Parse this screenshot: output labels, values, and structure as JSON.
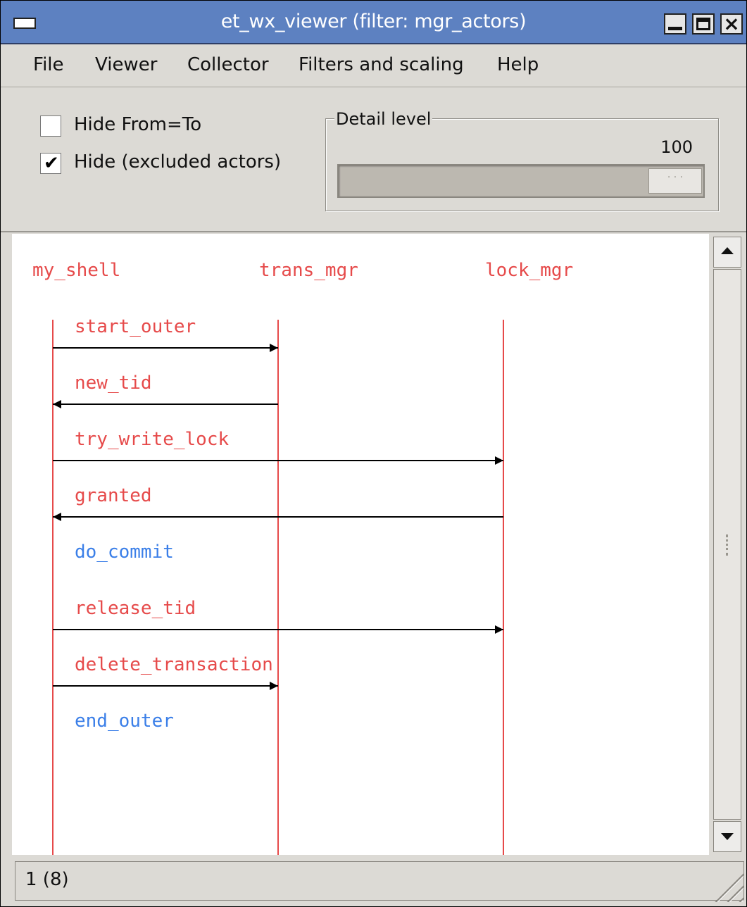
{
  "window": {
    "title": "et_wx_viewer (filter: mgr_actors)"
  },
  "menu": [
    "File",
    "Viewer",
    "Collector",
    "Filters and scaling",
    "Help"
  ],
  "controls": {
    "hide_from_to": {
      "label": "Hide From=To",
      "checked": false
    },
    "hide_excluded": {
      "label": "Hide (excluded actors)",
      "checked": true
    },
    "detail_level": {
      "legend": "Detail level",
      "value": "100"
    }
  },
  "diagram": {
    "actors": [
      "my_shell",
      "trans_mgr",
      "lock_mgr"
    ],
    "events": [
      {
        "label": "start_outer",
        "from": 0,
        "to": 1,
        "color": "#e64a4a"
      },
      {
        "label": "new_tid",
        "from": 1,
        "to": 0,
        "color": "#e64a4a"
      },
      {
        "label": "try_write_lock",
        "from": 0,
        "to": 2,
        "color": "#e64a4a"
      },
      {
        "label": "granted",
        "from": 2,
        "to": 0,
        "color": "#e64a4a"
      },
      {
        "label": "do_commit",
        "from": null,
        "to": null,
        "color": "#3b7fe8"
      },
      {
        "label": "release_tid",
        "from": 0,
        "to": 2,
        "color": "#e64a4a"
      },
      {
        "label": "delete_transaction",
        "from": 0,
        "to": 1,
        "color": "#e64a4a"
      },
      {
        "label": "end_outer",
        "from": null,
        "to": null,
        "color": "#3b7fe8"
      }
    ],
    "actor_color": "#e64a4a",
    "arrow_color": "#000000"
  },
  "status": {
    "text": "1 (8)"
  }
}
